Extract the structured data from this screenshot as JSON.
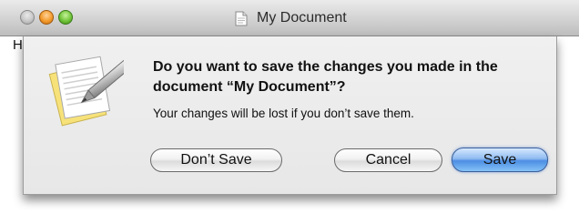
{
  "window": {
    "title": "My Document",
    "content_text": "H"
  },
  "dialog": {
    "headline": "Do you want to save the changes you made in the document “My Document”?",
    "message": "Your changes will be lost if you don’t save them.",
    "buttons": {
      "dont_save": "Don’t Save",
      "cancel": "Cancel",
      "save": "Save"
    },
    "default_button": "save",
    "icon": "textedit-document-pen-icon"
  },
  "colors": {
    "default_button_blue": "#4c8ee4",
    "close_button_gray": "#c8c8c8",
    "minimize_button_orange": "#f39b2c",
    "zoom_button_green": "#71c43a"
  }
}
